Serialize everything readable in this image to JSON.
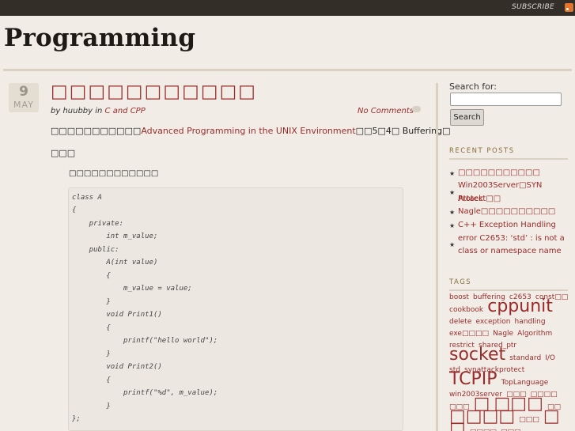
{
  "topbar": {
    "subscribe": "SUBSCRIBE",
    "rss_icon": "rss-icon"
  },
  "site": {
    "title": "Programming"
  },
  "post": {
    "day": "9",
    "month": "MAY",
    "title": "□□□□□□□□□□□",
    "by": "by huubby in ",
    "category": "C and CPP",
    "comments": "No Comments",
    "p1_pre": "□□□□□□□□□□□",
    "p1_link": "Advanced Programming in the UNIX Environment",
    "p1_post": "□□5□4□ Buffering□",
    "p2": "□□□",
    "p3": "□□□□□□□□□□□□",
    "code": [
      "class A",
      "{",
      "    private:",
      "        int m_value;",
      "    public:",
      "        A(int value)",
      "        {",
      "            m_value = value;",
      "        }",
      "        void Print1()",
      "        {",
      "            printf(\"hello world\");",
      "        }",
      "        void Print2()",
      "        {",
      "            printf(\"%d\", m_value);",
      "        }",
      "};"
    ]
  },
  "sidebar": {
    "search_label": "Search for:",
    "search_value": "",
    "search_button": "Search",
    "recent_heading": "RECENT POSTS",
    "recent_posts": [
      {
        "lines": [
          "□□□□□□□□□□□"
        ]
      },
      {
        "lines": [
          "Win2003Server□SYN Attack",
          "Protect□□"
        ]
      },
      {
        "lines": [
          "Nagle□□□□□□□□□□"
        ]
      },
      {
        "lines": [
          "C++ Exception Handling",
          "error C2653: ‘std’ : is not a",
          "class or namespace name"
        ]
      }
    ],
    "tags_heading": "TAGS",
    "tags": [
      {
        "t": "boost",
        "s": 9
      },
      {
        "t": "buffering",
        "s": 9
      },
      {
        "t": "c2653",
        "s": 9
      },
      {
        "t": "const□□",
        "s": 9
      },
      {
        "t": "cookbook",
        "s": 9
      },
      {
        "t": "cppunit",
        "s": 22
      },
      {
        "t": "delete",
        "s": 9
      },
      {
        "t": "exception",
        "s": 9
      },
      {
        "t": "handling",
        "s": 9
      },
      {
        "t": "exe□□□□",
        "s": 9
      },
      {
        "t": "Nagle",
        "s": 9
      },
      {
        "t": "Algorithm",
        "s": 9
      },
      {
        "t": "restrict",
        "s": 9
      },
      {
        "t": "shared_ptr",
        "s": 9
      },
      {
        "t": "socket",
        "s": 22
      },
      {
        "t": "standard",
        "s": 9
      },
      {
        "t": "I/O",
        "s": 9
      },
      {
        "t": "std",
        "s": 9
      },
      {
        "t": "synattackprotect",
        "s": 9
      },
      {
        "t": "TCPIP",
        "s": 22
      },
      {
        "t": "TopLanguage",
        "s": 9
      },
      {
        "t": "win2003server",
        "s": 9
      },
      {
        "t": "□□□",
        "s": 9
      },
      {
        "t": "□□□□",
        "s": 9
      },
      {
        "t": "□□□",
        "s": 9
      },
      {
        "t": "□",
        "s": 22
      },
      {
        "t": "□□□",
        "s": 22
      },
      {
        "t": "□□",
        "s": 9
      },
      {
        "t": "□□□□",
        "s": 22
      },
      {
        "t": "□□□",
        "s": 9
      },
      {
        "t": "□",
        "s": 22
      },
      {
        "t": "□",
        "s": 22
      },
      {
        "t": "□□□□",
        "s": 9
      },
      {
        "t": "□□□",
        "s": 9
      },
      {
        "t": "□□□□",
        "s": 22
      },
      {
        "t": "□□□",
        "s": 9
      }
    ]
  }
}
